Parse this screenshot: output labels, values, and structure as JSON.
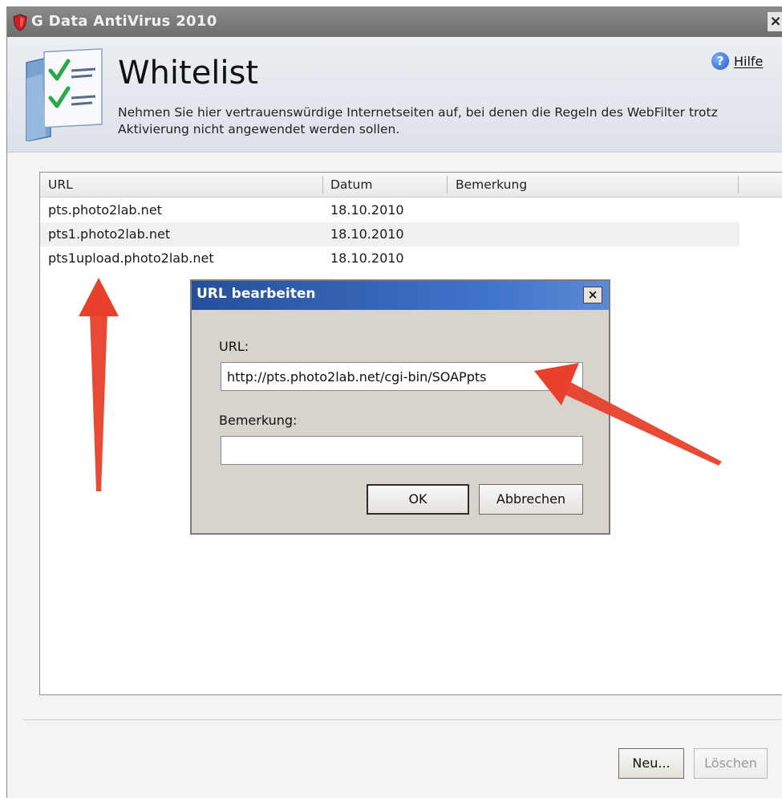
{
  "window": {
    "title": "G Data AntiVirus 2010",
    "close_glyph": "×"
  },
  "header": {
    "title": "Whitelist",
    "description": "Nehmen Sie hier vertrauenswürdige Internetseiten auf, bei denen die Regeln des WebFilter trotz Aktivierung nicht angewendet werden sollen.",
    "help_label": "Hilfe",
    "help_glyph": "?"
  },
  "list": {
    "columns": [
      "URL",
      "Datum",
      "Bemerkung"
    ],
    "rows": [
      {
        "url": "pts.photo2lab.net",
        "date": "18.10.2010",
        "note": ""
      },
      {
        "url": "pts1.photo2lab.net",
        "date": "18.10.2010",
        "note": ""
      },
      {
        "url": "pts1upload.photo2lab.net",
        "date": "18.10.2010",
        "note": ""
      }
    ]
  },
  "dialog": {
    "title": "URL bearbeiten",
    "close_glyph": "×",
    "url_label": "URL:",
    "url_value": "http://pts.photo2lab.net/cgi-bin/SOAPpts",
    "note_label": "Bemerkung:",
    "note_value": "",
    "ok_label": "OK",
    "cancel_label": "Abbrechen"
  },
  "footer": {
    "new_label": "Neu...",
    "delete_label": "Löschen"
  },
  "colors": {
    "annotation_arrow": "#e8402a",
    "dialog_title_bar": "#2f5fb0",
    "title_bar": "#7d7d7d"
  }
}
